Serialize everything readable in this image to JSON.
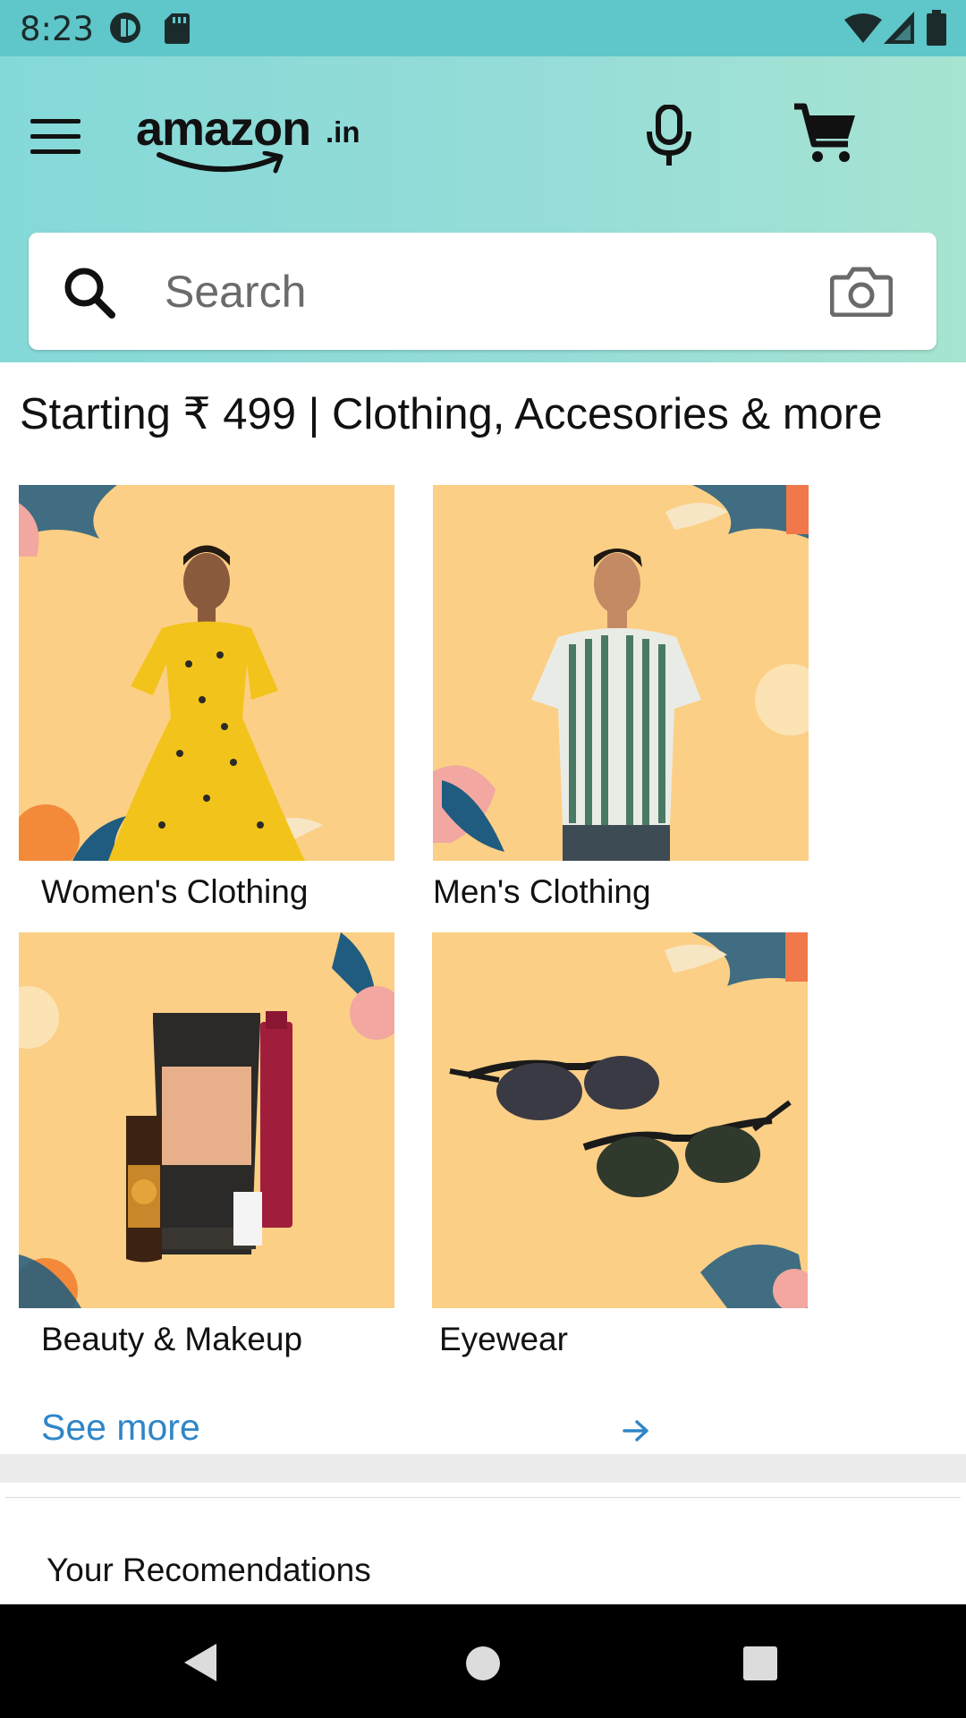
{
  "status_bar": {
    "time": "8:23",
    "icons": [
      "data-saver-icon",
      "sd-card-icon",
      "wifi-icon",
      "signal-icon",
      "battery-icon"
    ]
  },
  "header": {
    "logo_text": "amazon",
    "logo_suffix": ".in",
    "icons": [
      "menu-icon",
      "microphone-icon",
      "cart-icon"
    ]
  },
  "search": {
    "placeholder": "Search",
    "value": "",
    "icons": [
      "search-icon",
      "camera-icon"
    ]
  },
  "deal_section": {
    "title": "Starting ₹ 499 | Clothing, Accesories & more",
    "tiles": [
      {
        "label": "Women's Clothing"
      },
      {
        "label": "Men's Clothing"
      },
      {
        "label": "Beauty & Makeup"
      },
      {
        "label": "Eyewear"
      }
    ],
    "see_more": "See more"
  },
  "recommendations": {
    "title": "Your Recomendations"
  },
  "colors": {
    "status_bar": "#5fc6c9",
    "header_start": "#84d9d8",
    "header_end": "#a7e4d2",
    "tile_background": "#fccf86",
    "link": "#2f86c7"
  },
  "nav_bar": {
    "icons": [
      "back-icon",
      "home-icon",
      "recents-icon"
    ]
  }
}
